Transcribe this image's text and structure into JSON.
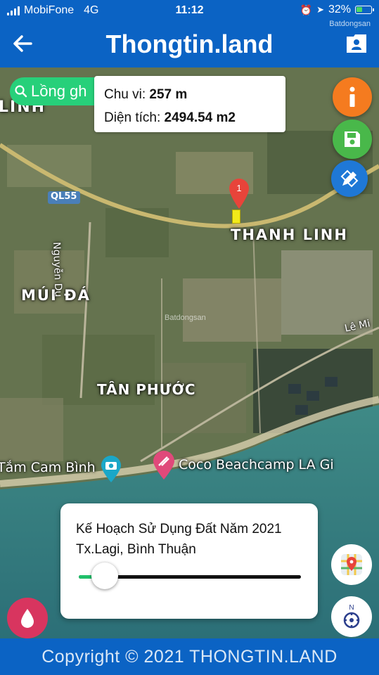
{
  "status_bar": {
    "carrier": "MobiFone",
    "network": "4G",
    "time": "11:12",
    "battery": "32%"
  },
  "header": {
    "title": "Thongtin.land",
    "watermark": "Batdongsan"
  },
  "search": {
    "text": "Lồng gh"
  },
  "measurement": {
    "perimeter_label": "Chu vi:",
    "perimeter_value": "257 m",
    "area_label": "Diện tích:",
    "area_value": "2494.54 m2"
  },
  "map": {
    "pin_number": "1",
    "labels": {
      "road": "QL55",
      "thanh_linh": "THANH LINH",
      "mui_da": "MÚI ĐÁ",
      "tan_phuoc": "TÂN PHƯỚC",
      "nguyen_du": "Nguyễn Du",
      "le_minh": "Lê Mi",
      "linh_edge": "LINH",
      "center_watermark": "Batdongsan"
    },
    "pois": {
      "tam_cam_binh": "Tắm Cam Bình",
      "coco": "Coco Beachcamp LA Gi"
    }
  },
  "plan_panel": {
    "title": "Kế Hoạch Sử Dụng Đất Năm 2021 Tx.Lagi, Bình Thuận",
    "opacity": 0.11
  },
  "footer": {
    "copyright": "Copyright © 2021 THONGTIN.LAND"
  },
  "colors": {
    "brand_blue": "#0b63c4",
    "info_orange": "#f57b1f",
    "save_green": "#49b84a",
    "draw_blue": "#1f78d6",
    "search_green": "#27d07a",
    "drop_pink": "#d8355f",
    "pin_red": "#e8443a",
    "parcel_yellow": "#f2ea1a"
  },
  "icons": [
    "back-arrow-icon",
    "id-card-icon",
    "search-icon",
    "info-icon",
    "save-icon",
    "pencil-ruler-icon",
    "water-drop-icon",
    "google-maps-icon",
    "compass-icon",
    "map-pin-icon",
    "camera-icon",
    "pink-location-icon"
  ]
}
